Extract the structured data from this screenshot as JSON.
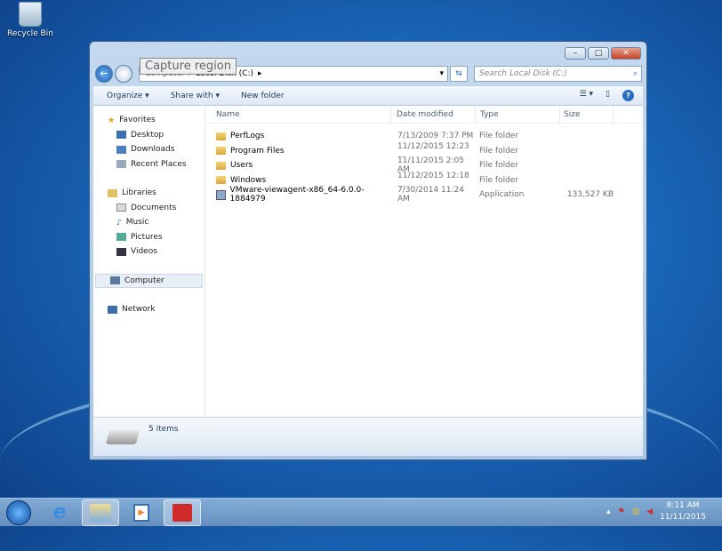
{
  "desktop": {
    "recycle_bin": "Recycle Bin"
  },
  "window": {
    "breadcrumb": [
      "Computer",
      "Local Disk (C:)"
    ],
    "tooltip": "Capture region",
    "search_placeholder": "Search Local Disk (C:)",
    "toolbar": {
      "organize": "Organize ▾",
      "share_with": "Share with ▾",
      "new_folder": "New folder"
    },
    "sidebar": {
      "favorites": "Favorites",
      "desktop": "Desktop",
      "downloads": "Downloads",
      "recent_places": "Recent Places",
      "libraries": "Libraries",
      "documents": "Documents",
      "music": "Music",
      "pictures": "Pictures",
      "videos": "Videos",
      "computer": "Computer",
      "network": "Network"
    },
    "columns": {
      "name": "Name",
      "date": "Date modified",
      "type": "Type",
      "size": "Size"
    },
    "files": [
      {
        "name": "PerfLogs",
        "date": "7/13/2009 7:37 PM",
        "type": "File folder",
        "size": ""
      },
      {
        "name": "Program Files",
        "date": "11/12/2015 12:23 ...",
        "type": "File folder",
        "size": ""
      },
      {
        "name": "Users",
        "date": "11/11/2015 2:05 AM",
        "type": "File folder",
        "size": ""
      },
      {
        "name": "Windows",
        "date": "11/12/2015 12:18 ...",
        "type": "File folder",
        "size": ""
      },
      {
        "name": "VMware-viewagent-x86_64-6.0.0-1884979",
        "date": "7/30/2014 11:24 AM",
        "type": "Application",
        "size": "133,527 KB"
      }
    ],
    "status": "5 items"
  },
  "taskbar": {
    "time": "8:11 AM",
    "date": "11/11/2015"
  }
}
